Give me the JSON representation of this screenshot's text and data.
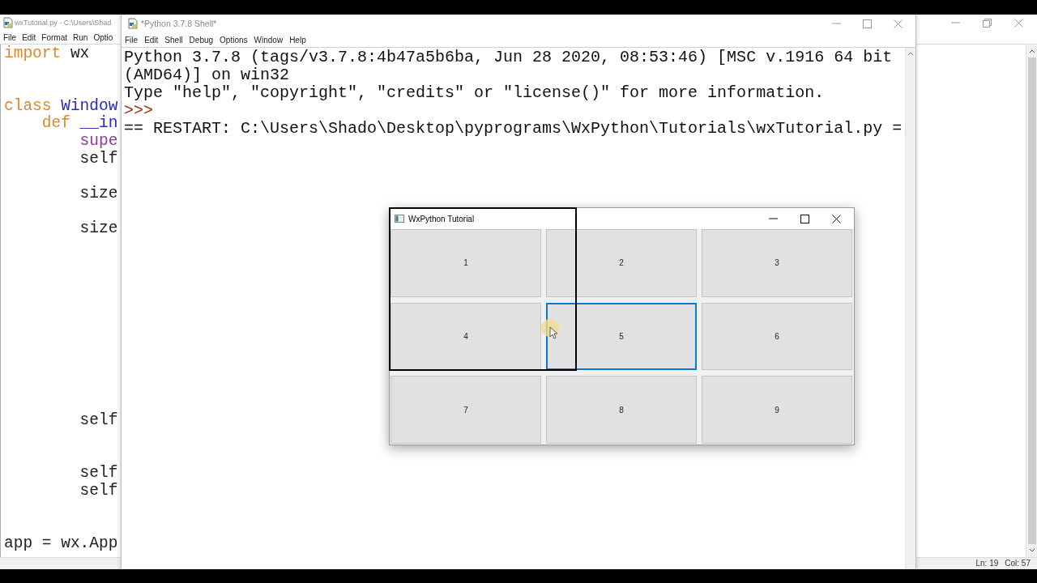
{
  "editor_window": {
    "title": "wxTutorial.py - C:\\Users\\Shad",
    "menu": [
      "File",
      "Edit",
      "Format",
      "Run",
      "Optio"
    ],
    "code_lines": [
      {
        "kind": "code",
        "tokens": [
          {
            "kind": "keyword",
            "text": "import"
          },
          {
            "kind": "plain",
            "text": " wx"
          }
        ]
      },
      {
        "kind": "blank"
      },
      {
        "kind": "blank"
      },
      {
        "kind": "code",
        "tokens": [
          {
            "kind": "keyword",
            "text": "class"
          },
          {
            "kind": "name",
            "text": " Window"
          }
        ]
      },
      {
        "kind": "code",
        "tokens": [
          {
            "kind": "keyword",
            "text": "    def"
          },
          {
            "kind": "name",
            "text": " __in"
          }
        ]
      },
      {
        "kind": "code",
        "tokens": [
          {
            "kind": "builtin",
            "text": "        supe"
          }
        ]
      },
      {
        "kind": "code",
        "tokens": [
          {
            "kind": "plain",
            "text": "        self"
          }
        ]
      },
      {
        "kind": "blank"
      },
      {
        "kind": "code",
        "tokens": [
          {
            "kind": "plain",
            "text": "        size"
          }
        ]
      },
      {
        "kind": "blank"
      },
      {
        "kind": "code",
        "tokens": [
          {
            "kind": "plain",
            "text": "        size"
          }
        ]
      },
      {
        "kind": "blank"
      },
      {
        "kind": "blank"
      },
      {
        "kind": "blank"
      },
      {
        "kind": "blank"
      },
      {
        "kind": "blank"
      },
      {
        "kind": "blank"
      },
      {
        "kind": "blank"
      },
      {
        "kind": "blank"
      },
      {
        "kind": "blank"
      },
      {
        "kind": "blank"
      },
      {
        "kind": "code",
        "tokens": [
          {
            "kind": "plain",
            "text": "        self"
          }
        ]
      },
      {
        "kind": "blank"
      },
      {
        "kind": "blank"
      },
      {
        "kind": "code",
        "tokens": [
          {
            "kind": "plain",
            "text": "        self"
          }
        ]
      },
      {
        "kind": "code",
        "tokens": [
          {
            "kind": "plain",
            "text": "        self"
          }
        ]
      },
      {
        "kind": "blank"
      },
      {
        "kind": "blank"
      },
      {
        "kind": "code",
        "tokens": [
          {
            "kind": "plain",
            "text": "app = wx.App"
          }
        ]
      }
    ],
    "status_bar": [
      "Ln: 19",
      "Col: 57"
    ]
  },
  "shell_window": {
    "title": "*Python 3.7.8 Shell*",
    "menu": [
      "File",
      "Edit",
      "Shell",
      "Debug",
      "Options",
      "Window",
      "Help"
    ],
    "lines": [
      {
        "kind": "output",
        "text": "Python 3.7.8 (tags/v3.7.8:4b47a5b6ba, Jun 28 2020, 08:53:46) [MSC v.1916 64 bit"
      },
      {
        "kind": "output",
        "text": "(AMD64)] on win32"
      },
      {
        "kind": "output",
        "text": "Type \"help\", \"copyright\", \"credits\" or \"license()\" for more information."
      },
      {
        "kind": "prompt",
        "text": ">>>"
      },
      {
        "kind": "output",
        "text": "== RESTART: C:\\Users\\Shado\\Desktop\\pyprograms\\WxPython\\Tutorials\\wxTutorial.py ="
      }
    ]
  },
  "wx_window": {
    "title": "WxPython Tutorial",
    "buttons": [
      {
        "label": "1",
        "focused": false
      },
      {
        "label": "2",
        "focused": false
      },
      {
        "label": "3",
        "focused": false
      },
      {
        "label": "4",
        "focused": false
      },
      {
        "label": "5",
        "focused": true
      },
      {
        "label": "6",
        "focused": false
      },
      {
        "label": "7",
        "focused": false
      },
      {
        "label": "8",
        "focused": false
      },
      {
        "label": "9",
        "focused": false
      }
    ]
  }
}
